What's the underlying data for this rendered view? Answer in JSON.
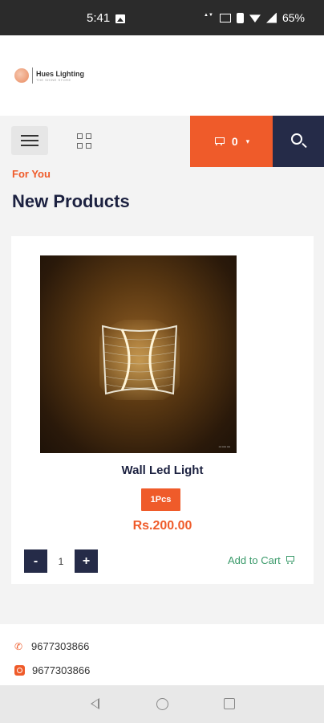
{
  "status_bar": {
    "time": "5:41",
    "battery": "65%",
    "icons": [
      "image-icon",
      "data-speed-icon",
      "sim-icon",
      "vibrate-icon",
      "wifi-icon",
      "signal-icon"
    ]
  },
  "header": {
    "logo_name": "Hues Lighting",
    "logo_tagline": "THE SHINE STORE"
  },
  "navbar": {
    "cart_count": "0"
  },
  "section": {
    "eyebrow": "For You",
    "title": "New Products"
  },
  "product": {
    "name": "Wall Led Light",
    "unit": "1Pcs",
    "price": "Rs.200.00",
    "quantity": "1",
    "minus_label": "-",
    "plus_label": "+",
    "add_to_cart": "Add to Cart"
  },
  "footer": {
    "phone": "9677303866",
    "whatsapp": "9677303866"
  },
  "colors": {
    "accent": "#ef5b2a",
    "navy": "#252b48",
    "green": "#3a9a6a"
  }
}
